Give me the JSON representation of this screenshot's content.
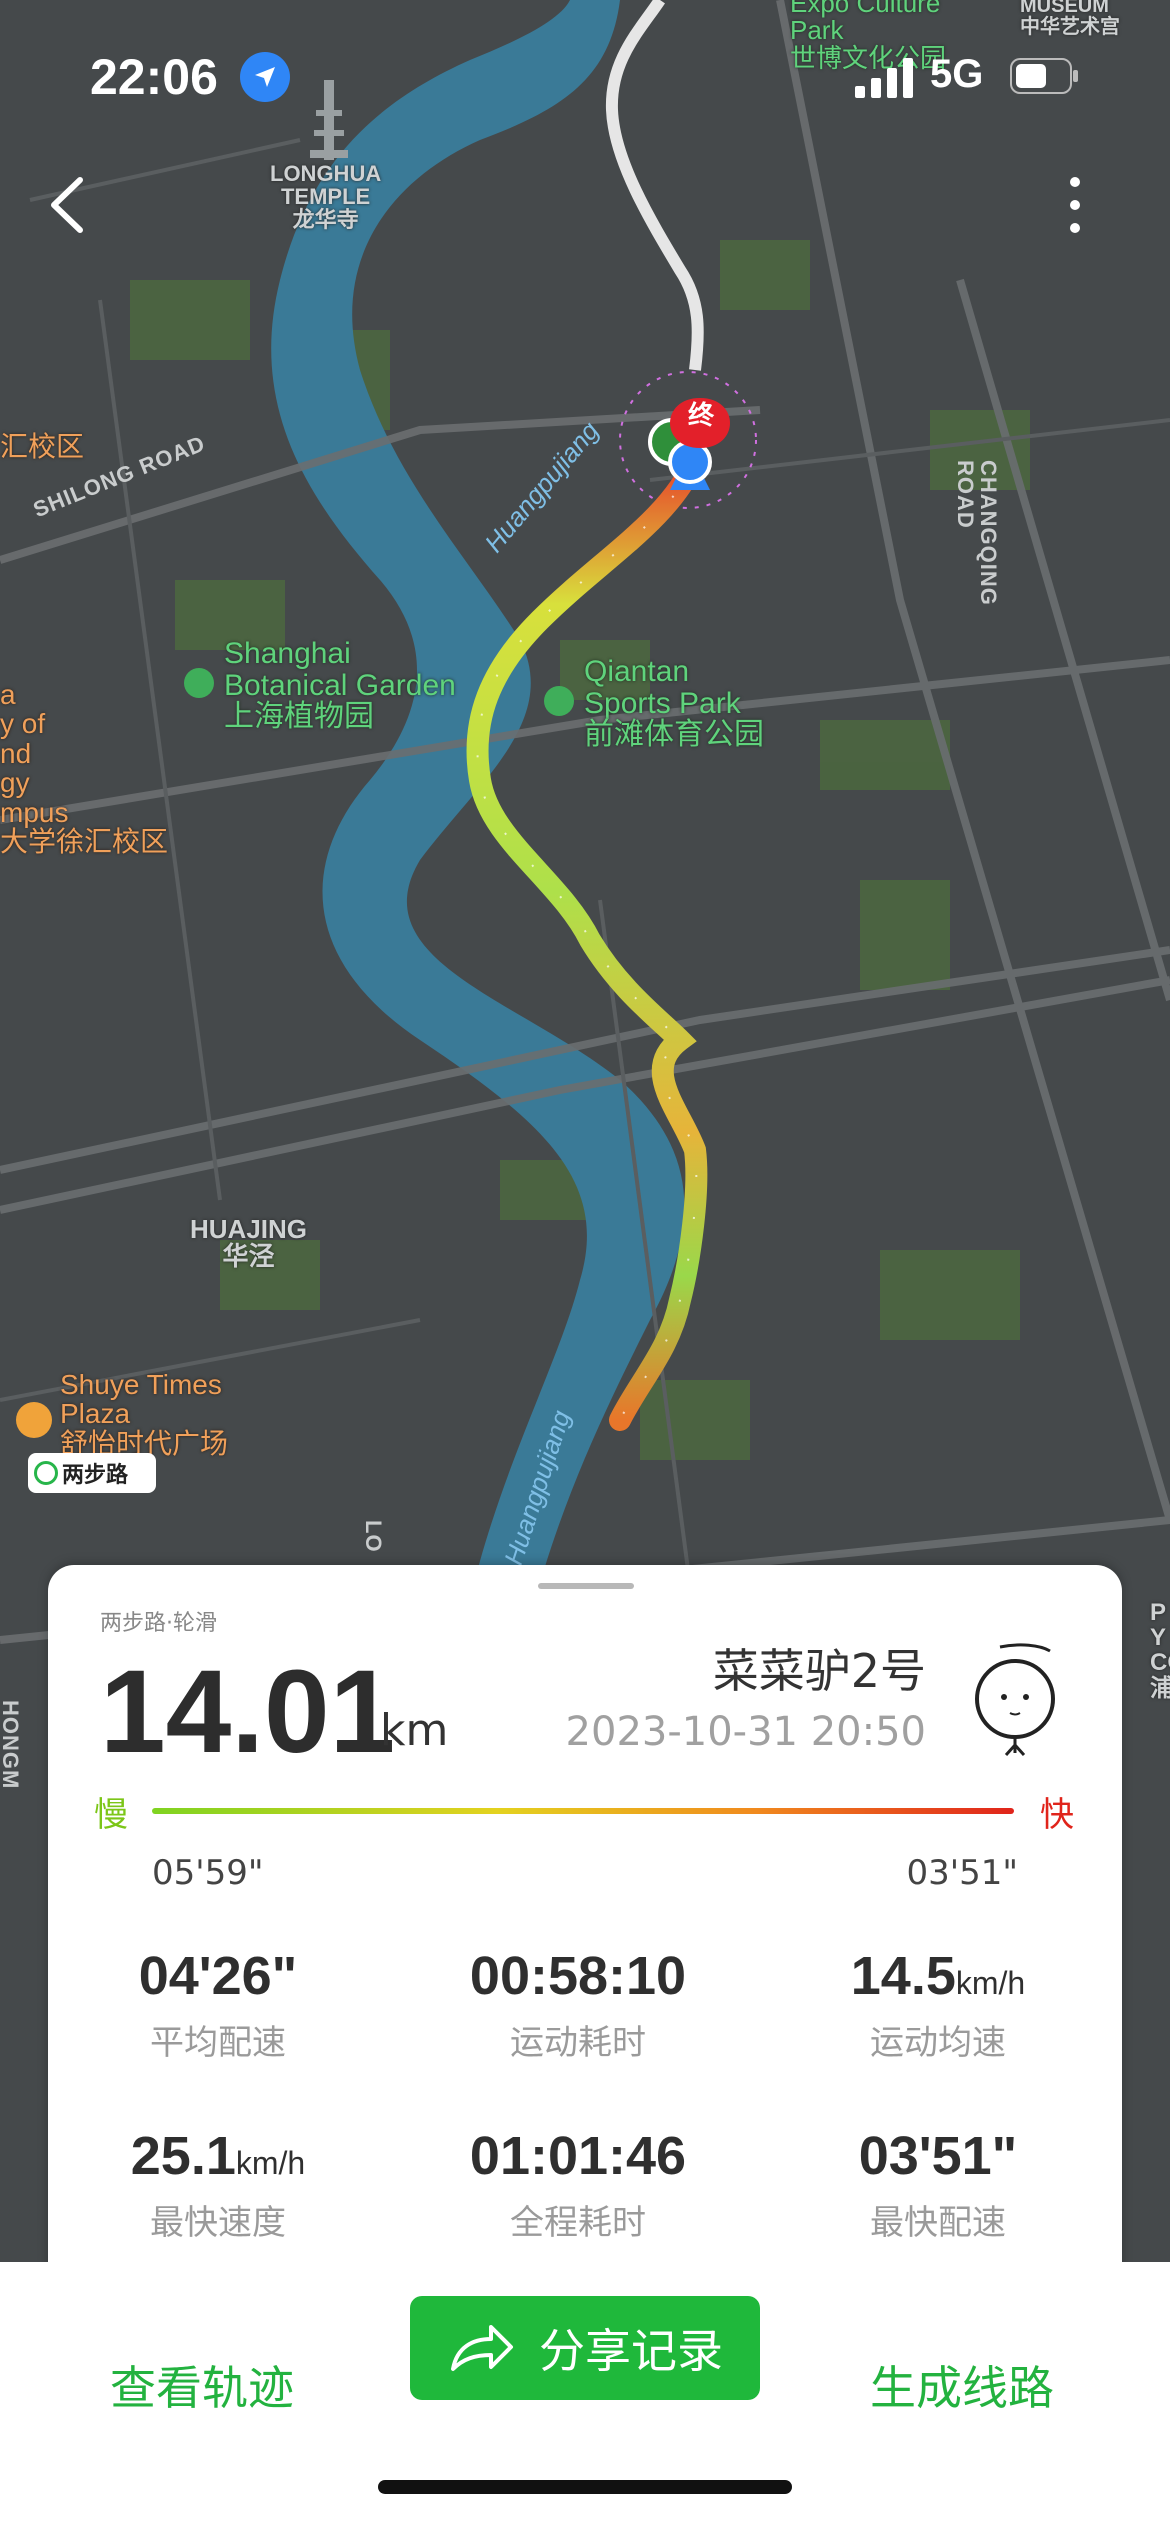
{
  "status_bar": {
    "time": "22:06",
    "network": "5G"
  },
  "map": {
    "labels": {
      "longhua": [
        "LONGHUA",
        "TEMPLE",
        "龙华寺"
      ],
      "expo": [
        "Expo Culture",
        "Park",
        "世博文化公园"
      ],
      "museum": [
        "MUSEUM",
        "中华艺术宫"
      ],
      "botanical": [
        "Shanghai",
        "Botanical Garden",
        "上海植物园"
      ],
      "qiantan": [
        "Qiantan",
        "Sports Park",
        "前滩体育公园"
      ],
      "huajing": [
        "HUAJING",
        "华泾"
      ],
      "shuye": [
        "Shuye Times",
        "Plaza",
        "舒怡时代广场"
      ],
      "campus_1": "汇校区",
      "campus_2": [
        "a",
        "y of",
        "nd",
        "gy",
        "mpus",
        "大学徐汇校区"
      ],
      "shilong_road": "SHILONG ROAD",
      "changqing_road": "CHANGQING ROAD",
      "river_1": "Huangpujiang",
      "river_2": "Huangpujiang",
      "end_marker": "终",
      "partial_right": [
        "P",
        "Y",
        "COL",
        "浦江"
      ],
      "partial_bottom_left": "HONGM",
      "partial_road": "LO"
    },
    "watermark": "两步路"
  },
  "card": {
    "sport": "两步路·轮滑",
    "distance": "14.01",
    "distance_unit": "km",
    "username": "菜菜驴2号",
    "datetime": "2023-10-31 20:50",
    "slow_label": "慢",
    "fast_label": "快",
    "pace_min": "05'59\"",
    "pace_max": "03'51\"",
    "stats": [
      {
        "value": "04'26\"",
        "suffix": "",
        "label": "平均配速"
      },
      {
        "value": "00:58:10",
        "suffix": "",
        "label": "运动耗时"
      },
      {
        "value": "14.5",
        "suffix": "km/h",
        "label": "运动均速"
      },
      {
        "value": "25.1",
        "suffix": "km/h",
        "label": "最快速度"
      },
      {
        "value": "01:01:46",
        "suffix": "",
        "label": "全程耗时"
      },
      {
        "value": "03'51\"",
        "suffix": "",
        "label": "最快配速"
      }
    ]
  },
  "bottom_bar": {
    "view_track": "查看轨迹",
    "share": "分享记录",
    "generate_route": "生成线路"
  },
  "colors": {
    "accent_green": "#1fb83b",
    "slow": "#7cc618",
    "fast": "#e0241b",
    "river": "#3a7a97"
  }
}
